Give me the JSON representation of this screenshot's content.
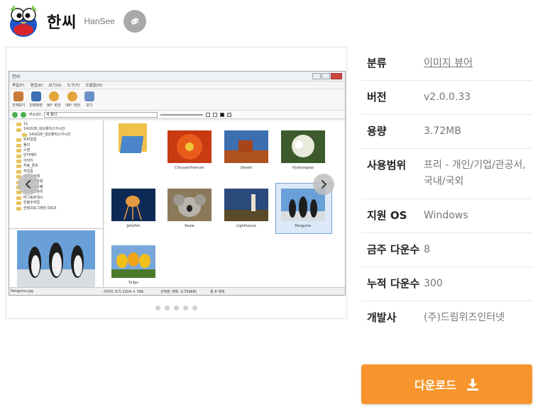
{
  "header": {
    "app_name": "한씨",
    "app_eng": "HanSee"
  },
  "screenshot": {
    "window_title": "한씨",
    "menu": [
      "파일(F)",
      "편집(E)",
      "보기(V)",
      "도구(T)",
      "도움말(H)"
    ],
    "toolbar": [
      "크게보기",
      "전체화면",
      "90° 회전",
      "-90° 회전",
      "보기"
    ],
    "address": "새 폴더",
    "address_label": "주소(D)",
    "tree_items": [
      "11",
      "141028_네오플럭스카시안",
      "141028_네오플럭스카시안",
      "트바일업",
      "폴리",
      "스캔",
      "안카메라",
      "이미지",
      "자료_폰트",
      "작업중",
      "지식인삭제",
      "폰트플바와칭",
      "타사프로그램",
      "테그림표현지",
      "테그림프레시",
      "한불조작업",
      "한컴프로그래밍 0915"
    ],
    "thumbs": [
      "",
      "Chrysanthemum",
      "Desert",
      "Hydrangeas",
      "Jellyfish",
      "Koala",
      "Lighthouse",
      "Penguins",
      "Tulips"
    ],
    "status_file": "Penguins.jpg",
    "status_size": "이미지 크기:1024 × 768",
    "status_sel": "선택된 개체: 1(759KB)",
    "status_total": "총 8 개체"
  },
  "info": [
    {
      "label": "분류",
      "value": "이미지 뷰어"
    },
    {
      "label": "버전",
      "value": "v2.0.0.33"
    },
    {
      "label": "용량",
      "value": "3.72MB"
    },
    {
      "label": "사용범위",
      "value": "프리 - 개인/기업/관공서, 국내/국외"
    },
    {
      "label": "지원 OS",
      "value": "Windows"
    },
    {
      "label": "금주 다운수",
      "value": "8"
    },
    {
      "label": "누적 다운수",
      "value": "300"
    },
    {
      "label": "개발사",
      "value": "(주)드림위즈인터넷"
    }
  ],
  "download_label": "다운로드",
  "colors": {
    "download": "#f7952c",
    "link_button": "#a9a9a9"
  },
  "carousel": {
    "dot_count": 5
  }
}
